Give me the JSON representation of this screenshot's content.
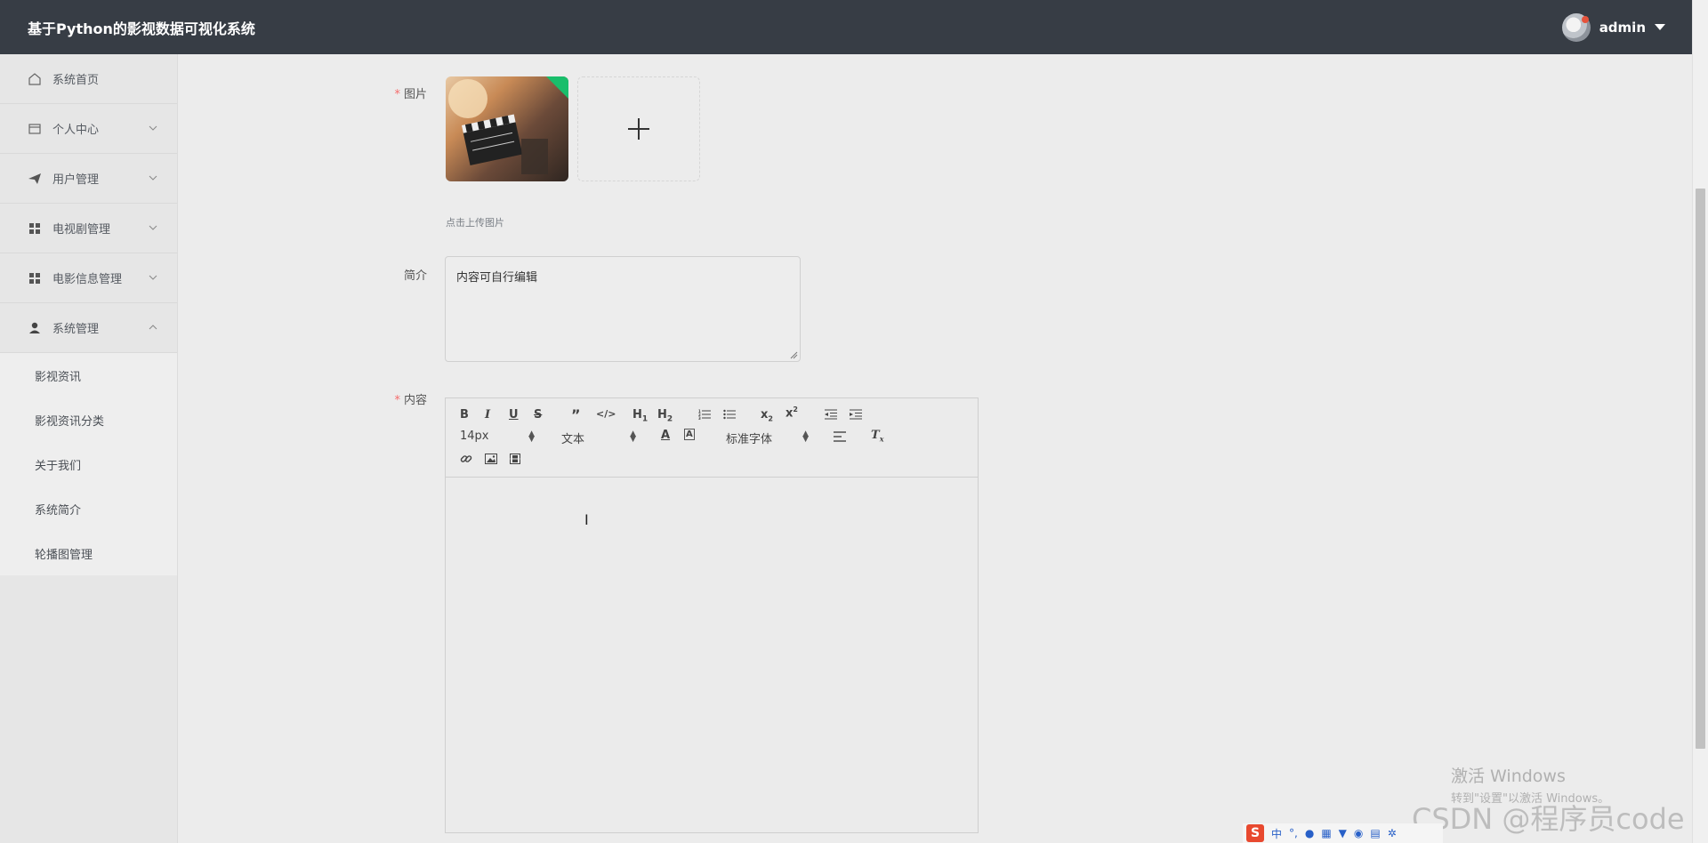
{
  "header": {
    "title": "基于Python的影视数据可视化系统",
    "username": "admin"
  },
  "sidebar": {
    "items": [
      {
        "label": "系统首页",
        "icon": "home-icon"
      },
      {
        "label": "个人中心",
        "icon": "card-icon"
      },
      {
        "label": "用户管理",
        "icon": "send-icon"
      },
      {
        "label": "电视剧管理",
        "icon": "grid-icon"
      },
      {
        "label": "电影信息管理",
        "icon": "grid-icon"
      },
      {
        "label": "系统管理",
        "icon": "user-icon"
      }
    ],
    "submenu": [
      "影视资讯",
      "影视资讯分类",
      "关于我们",
      "系统简介",
      "轮播图管理"
    ]
  },
  "form": {
    "image_label": "图片",
    "upload_hint": "点击上传图片",
    "intro_label": "简介",
    "intro_value": "内容可自行编辑",
    "content_label": "内容",
    "required_mark": "*"
  },
  "editor": {
    "font_size": "14px",
    "header_select": "文本",
    "font_family": "标准字体",
    "buttons": [
      "bold",
      "italic",
      "underline",
      "strike",
      "blockquote",
      "code-block",
      "h1",
      "h2",
      "ordered-list",
      "bullet-list",
      "subscript",
      "superscript",
      "outdent",
      "indent",
      "font-color",
      "background-color",
      "align",
      "clean",
      "link",
      "image",
      "video"
    ]
  },
  "watermark": {
    "line1": "激活 Windows",
    "line2": "转到\"设置\"以激活 Windows。",
    "csdn": "CSDN @程序员code"
  },
  "ime": {
    "label": "中"
  }
}
